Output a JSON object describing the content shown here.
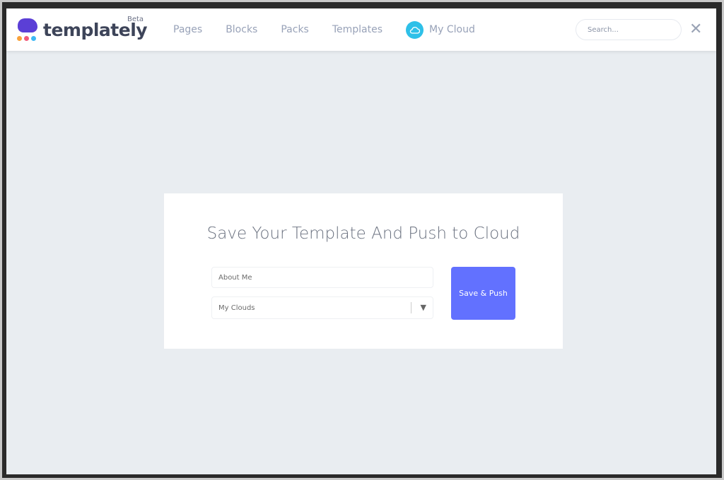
{
  "header": {
    "brand": "templately",
    "badge": "Beta",
    "nav": [
      {
        "label": "Pages"
      },
      {
        "label": "Blocks"
      },
      {
        "label": "Packs"
      },
      {
        "label": "Templates"
      },
      {
        "label": "My Cloud",
        "icon": "cloud-icon"
      }
    ],
    "search_placeholder": "Search...",
    "close_icon": "close-icon"
  },
  "dialog": {
    "title": "Save Your Template And Push to Cloud",
    "name_value": "About Me",
    "cloud_select": "My Clouds",
    "submit_label": "Save & Push",
    "accent": "#6271ff"
  }
}
